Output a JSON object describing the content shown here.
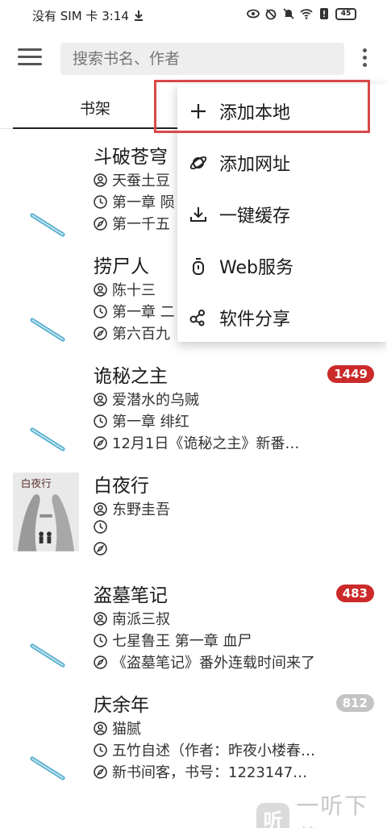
{
  "status_bar": {
    "left_text": "没有 SIM 卡 3:14",
    "battery": "45"
  },
  "toolbar": {
    "search_placeholder": "搜索书名、作者"
  },
  "tabs": [
    {
      "label": "书架",
      "active": true
    }
  ],
  "popup_menu": {
    "items": [
      {
        "label": "添加本地",
        "icon": "plus-icon",
        "highlighted": true
      },
      {
        "label": "添加网址",
        "icon": "planet-icon"
      },
      {
        "label": "一键缓存",
        "icon": "download-icon"
      },
      {
        "label": "Web服务",
        "icon": "web-service-icon"
      },
      {
        "label": "软件分享",
        "icon": "share-icon"
      }
    ]
  },
  "books": [
    {
      "title": "斗破苍穹",
      "author": "天蚕土豆",
      "chapter": "第一章 陨",
      "latest": "第一千五",
      "badge": null,
      "cover": "default-cover"
    },
    {
      "title": "捞尸人",
      "author": "陈十三",
      "chapter": "第一章 二",
      "latest": "第六百九",
      "badge": null,
      "cover": "default-cover"
    },
    {
      "title": "诡秘之主",
      "author": "爱潜水的乌贼",
      "chapter": "第一章 绯红",
      "latest": "12月1日《诡秘之主》新番…",
      "badge": "1449",
      "badge_color": "#cc2a2a",
      "cover": "default-cover"
    },
    {
      "title": "白夜行",
      "author": "东野圭吾",
      "chapter": "",
      "latest": "",
      "badge": null,
      "cover": "image-cover",
      "cover_title": "白夜行"
    },
    {
      "title": "盗墓笔记",
      "author": "南派三叔",
      "chapter": "七星鲁王 第一章 血尸",
      "latest": "《盗墓笔记》番外连载时间来了",
      "badge": "483",
      "badge_color": "#cc2a2a",
      "cover": "default-cover"
    },
    {
      "title": "庆余年",
      "author": "猫腻",
      "chapter": "五竹自述（作者：昨夜小楼春…",
      "latest": "新书间客，书号：1223147…",
      "badge": "812",
      "badge_color": "#c4c4c4",
      "cover": "default-cover"
    }
  ],
  "watermark": {
    "logo": "听",
    "text": "一听下载"
  }
}
